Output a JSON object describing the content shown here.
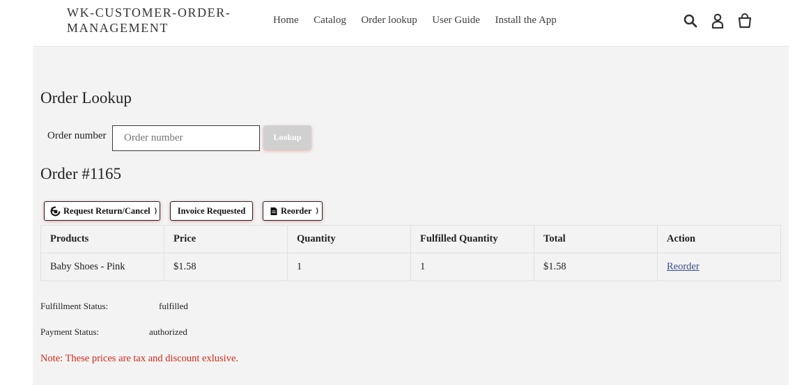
{
  "header": {
    "logo": "WK-CUSTOMER-ORDER-MANAGEMENT",
    "nav": [
      "Home",
      "Catalog",
      "Order lookup",
      "User Guide",
      "Install the App"
    ],
    "icons": [
      "search-icon",
      "account-icon",
      "cart-icon"
    ]
  },
  "lookup": {
    "title": "Order Lookup",
    "label": "Order number",
    "placeholder": "Order number",
    "value": "",
    "button": "Lookup"
  },
  "order": {
    "title": "Order #1165",
    "actions": {
      "return_cancel": "Request Return/Cancel",
      "invoice": "Invoice Requested",
      "reorder": "Reorder"
    },
    "table": {
      "headers": [
        "Products",
        "Price",
        "Quantity",
        "Fulfilled Quantity",
        "Total",
        "Action"
      ],
      "rows": [
        {
          "product": "Baby Shoes - Pink",
          "price": "$1.58",
          "quantity": "1",
          "fulfilled": "1",
          "total": "$1.58",
          "action": "Reorder"
        }
      ]
    },
    "fulfillment_label": "Fulfillment Status:",
    "fulfillment_value": "fulfilled",
    "payment_label": "Payment Status:",
    "payment_value": "authorized",
    "note": "Note: These prices are tax and discount exlusive."
  },
  "colors": {
    "note": "#d22a1a",
    "panel_bg": "#f3f3f3",
    "link": "#3a4f8f"
  }
}
